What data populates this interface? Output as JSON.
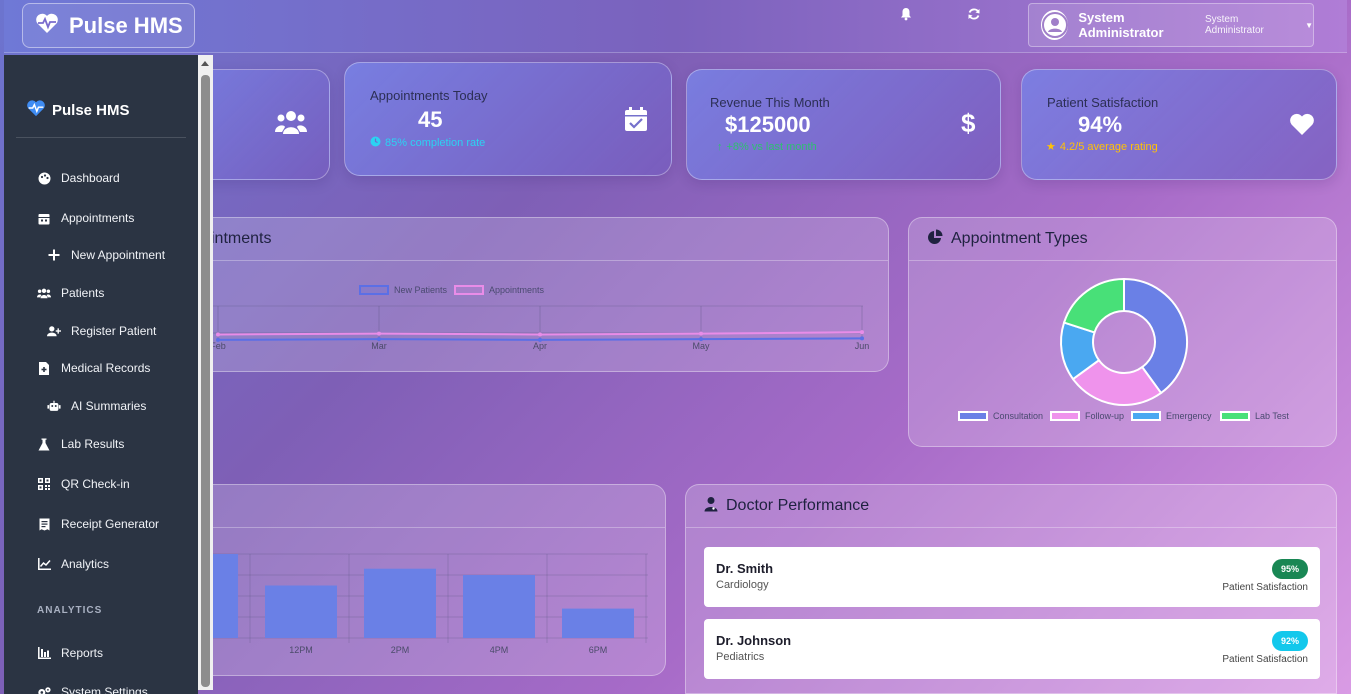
{
  "navbar": {
    "brand": "Pulse HMS",
    "user_name": "System Administrator",
    "user_role": "System Administrator"
  },
  "sidebar": {
    "brand": "Pulse HMS",
    "items": [
      {
        "label": "Dashboard",
        "icon": "palette-icon"
      },
      {
        "label": "Appointments",
        "icon": "calendar-icon"
      },
      {
        "label": "New Appointment",
        "icon": "plus-icon"
      },
      {
        "label": "Patients",
        "icon": "users-icon"
      },
      {
        "label": "Register Patient",
        "icon": "user-plus-icon"
      },
      {
        "label": "Medical Records",
        "icon": "file-medical-icon"
      },
      {
        "label": "AI Summaries",
        "icon": "robot-icon"
      },
      {
        "label": "Lab Results",
        "icon": "flask-icon"
      },
      {
        "label": "QR Check-in",
        "icon": "qrcode-icon"
      },
      {
        "label": "Receipt Generator",
        "icon": "receipt-icon"
      },
      {
        "label": "Analytics",
        "icon": "chart-line-icon"
      }
    ],
    "section_label": "ANALYTICS",
    "section_items": [
      {
        "label": "Reports",
        "icon": "chart-bar-icon"
      },
      {
        "label": "System Settings",
        "icon": "cogs-icon"
      }
    ]
  },
  "stats": {
    "appointments": {
      "label": "Appointments Today",
      "value": "45",
      "sub": "85% completion rate"
    },
    "revenue": {
      "label": "Revenue This Month",
      "value": "$125000",
      "sub": "+8% vs last month"
    },
    "satisfaction": {
      "label": "Patient Satisfaction",
      "value": "94%",
      "sub": "4.2/5 average rating"
    }
  },
  "trend_panel": {
    "title_visible": "intments",
    "legend": [
      "New Patients",
      "Appointments"
    ],
    "x_labels": [
      "Feb",
      "Mar",
      "Apr",
      "May",
      "Jun"
    ]
  },
  "types_panel": {
    "title": "Appointment Types",
    "legend": [
      "Consultation",
      "Follow-up",
      "Emergency",
      "Lab Test"
    ]
  },
  "hourly_panel": {
    "x_labels": [
      "12PM",
      "2PM",
      "4PM",
      "6PM"
    ]
  },
  "doctor_panel": {
    "title": "Doctor Performance",
    "doctors": [
      {
        "name": "Dr. Smith",
        "specialty": "Cardiology",
        "score": "95%",
        "score_label": "Patient Satisfaction"
      },
      {
        "name": "Dr. Johnson",
        "specialty": "Pediatrics",
        "score": "92%",
        "score_label": "Patient Satisfaction"
      }
    ]
  },
  "chart_data": [
    {
      "type": "line",
      "title": "",
      "x": [
        "Feb",
        "Mar",
        "Apr",
        "May",
        "Jun"
      ],
      "series": [
        {
          "name": "New Patients",
          "values": [
            18,
            19,
            18,
            19,
            20
          ],
          "color": "#5b6fe6"
        },
        {
          "name": "Appointments",
          "values": [
            25,
            26,
            25,
            26,
            28
          ],
          "color": "#e98ce8"
        }
      ]
    },
    {
      "type": "pie",
      "title": "Appointment Types",
      "categories": [
        "Consultation",
        "Follow-up",
        "Emergency",
        "Lab Test"
      ],
      "values": [
        40,
        25,
        15,
        20
      ],
      "colors": [
        "#6a80e6",
        "#ef93ec",
        "#4aa8f1",
        "#48e078"
      ]
    },
    {
      "type": "bar",
      "title": "",
      "categories": [
        "12PM",
        "2PM",
        "4PM",
        "6PM"
      ],
      "values": [
        50,
        66,
        60,
        28
      ],
      "color": "#6a80e6"
    }
  ],
  "colors": {
    "sidebar_bg": "#2b3443",
    "accent_cyan": "#2bd3f2",
    "accent_green": "#2fbf71",
    "accent_yellow": "#ffc107",
    "badge_green": "#198754",
    "badge_cyan": "#13c8ec"
  }
}
